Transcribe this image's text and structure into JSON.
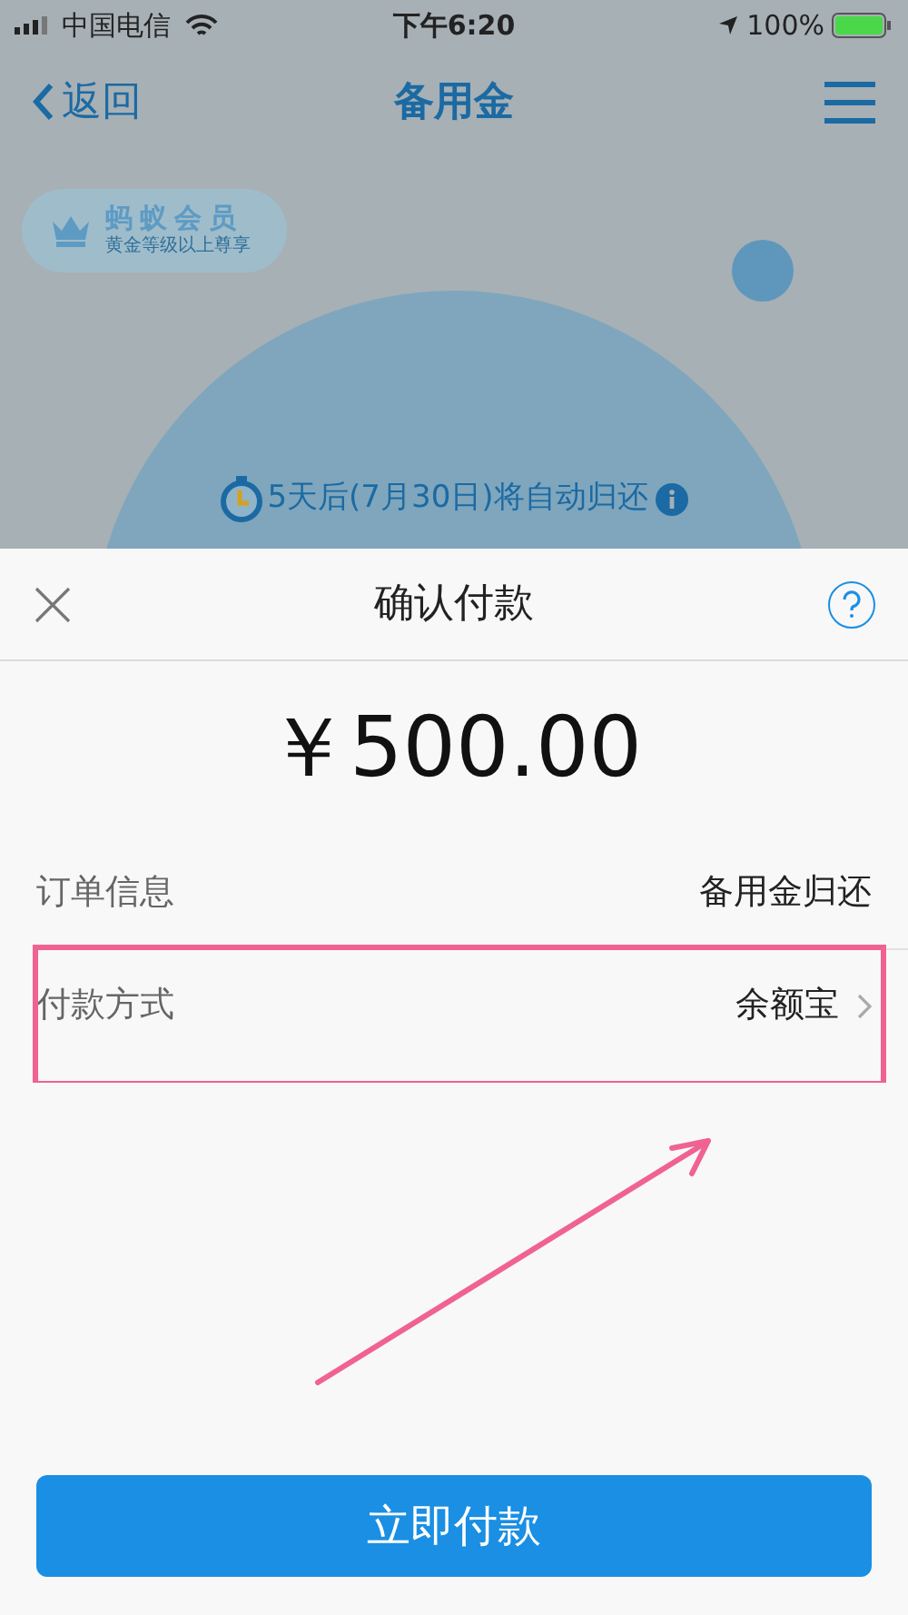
{
  "status_bar": {
    "carrier": "中国电信",
    "time": "下午6:20",
    "battery": "100%"
  },
  "nav": {
    "back_label": "返回",
    "title": "备用金"
  },
  "member_badge": {
    "title": "蚂蚁会员",
    "subtitle": "黄金等级以上尊享"
  },
  "due_notice": "5天后(7月30日)将自动归还",
  "sheet": {
    "title": "确认付款",
    "amount": "￥500.00",
    "rows": [
      {
        "label": "订单信息",
        "value": "备用金归还",
        "kind": "info",
        "highlighted": false
      },
      {
        "label": "付款方式",
        "value": "余额宝",
        "kind": "link",
        "highlighted": true
      }
    ],
    "pay_button": "立即付款"
  }
}
